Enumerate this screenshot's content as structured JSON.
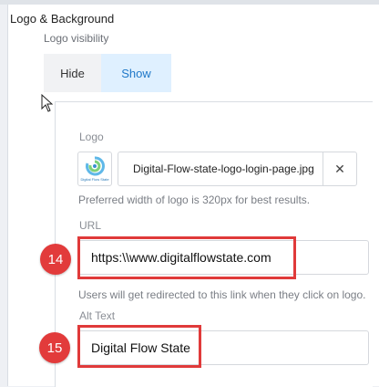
{
  "section_title": "Logo & Background",
  "logo_visibility": {
    "label": "Logo visibility",
    "options": [
      "Hide",
      "Show"
    ],
    "selected": "Show"
  },
  "logo": {
    "label": "Logo",
    "thumbnail_caption": "Digital Flow State",
    "file_name": "Digital-Flow-state-logo-login-page.jpg",
    "clear_icon": "close-icon",
    "help": "Preferred width of logo is 320px for best results."
  },
  "url": {
    "label": "URL",
    "value": "https:\\\\www.digitalflowstate.com",
    "help": "Users will get redirected to this link when they click on logo."
  },
  "alt_text": {
    "label": "Alt Text",
    "value": "Digital Flow State"
  },
  "annotations": {
    "badge_url": "14",
    "badge_alt": "15",
    "color": "#e03a3a"
  },
  "colors": {
    "selected_bg": "#dff0ff",
    "selected_text": "#1f78c8"
  }
}
